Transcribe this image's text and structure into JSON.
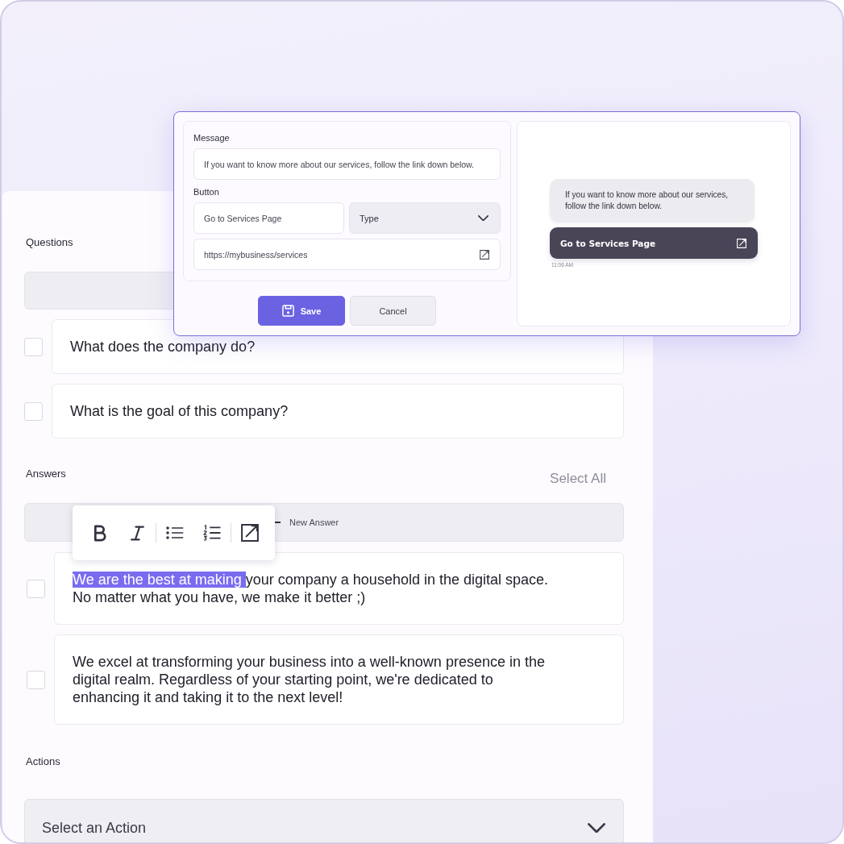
{
  "editor_dialog": {
    "message": {
      "label": "Message",
      "value": "If you want to know more about our services, follow the link down below."
    },
    "button": {
      "label": "Button",
      "text": {
        "value": "Go to Services Page"
      },
      "type": {
        "placeholder": "Type"
      },
      "url": {
        "value": "https://mybusiness/services"
      }
    },
    "actions": [
      {
        "label": "Save",
        "kind": "primary"
      },
      {
        "label": "Cancel",
        "kind": "secondary"
      }
    ],
    "preview": {
      "message": "If you want to know more about our services,\nfollow the link down below.",
      "button_label": "Go to Services Page",
      "time": "11:06 AM"
    }
  },
  "questions": {
    "title": "Questions",
    "items": [
      {
        "text": "What does the company do?",
        "checked": false
      },
      {
        "text": "What is the goal of this company?",
        "checked": false
      }
    ]
  },
  "answers": {
    "title": "Answers",
    "select_all": "Select All",
    "new_answer": "New Answer",
    "format_toolbar": [
      {
        "kind": "bold"
      },
      {
        "kind": "italic"
      },
      {
        "kind": "separator"
      },
      {
        "kind": "bullet_list"
      },
      {
        "kind": "numbered_list"
      },
      {
        "kind": "separator"
      },
      {
        "kind": "link"
      }
    ],
    "items": [
      {
        "checked": false,
        "parts": [
          {
            "text": "We are the best at making ",
            "selected": true
          },
          {
            "text": "your company a household in the digital space.\nNo matter what you have, we make it better ;)",
            "selected": false
          }
        ]
      },
      {
        "checked": false,
        "parts": [
          {
            "text": "We excel at transforming your business into a well-known presence in the\ndigital realm. Regardless of your starting point, we're dedicated to\nenhancing it and taking it to the next level!",
            "selected": false
          }
        ]
      }
    ]
  },
  "actions": {
    "title": "Actions",
    "placeholder": "Select an Action"
  }
}
